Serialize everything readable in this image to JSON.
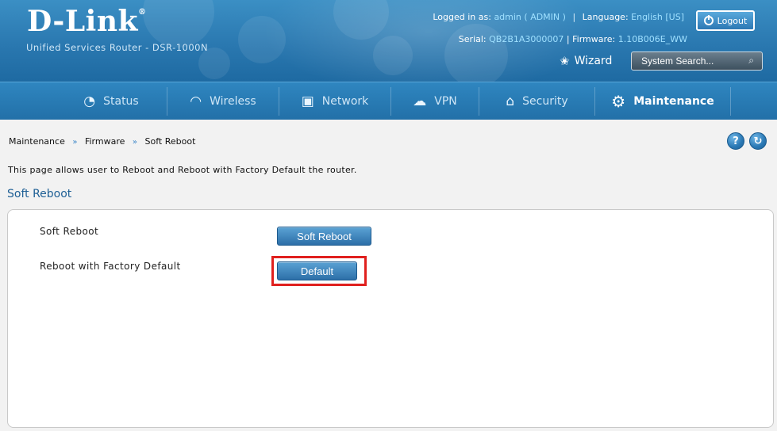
{
  "brand": {
    "logo": "D-Link",
    "registered": "®",
    "subtitle": "Unified Services Router - DSR-1000N"
  },
  "session": {
    "logged_in_label": "Logged in as:",
    "user": "admin ( ADMIN )",
    "language_label": "Language:",
    "language": "English [US]",
    "serial_label": "Serial:",
    "serial": "QB2B1A3000007",
    "firmware_label": "Firmware:",
    "firmware": "1.10B006E_WW"
  },
  "header": {
    "logout_label": "Logout",
    "wizard_label": "Wizard",
    "search_placeholder": "System Search..."
  },
  "nav": {
    "items": [
      {
        "label": "Status",
        "icon": "gauge-icon"
      },
      {
        "label": "Wireless",
        "icon": "wifi-icon"
      },
      {
        "label": "Network",
        "icon": "monitor-icon"
      },
      {
        "label": "VPN",
        "icon": "cloud-lock-icon"
      },
      {
        "label": "Security",
        "icon": "lock-icon"
      },
      {
        "label": "Maintenance",
        "icon": "gears-icon",
        "active": true
      }
    ]
  },
  "breadcrumb": [
    "Maintenance",
    "Firmware",
    "Soft Reboot"
  ],
  "page": {
    "description": "This page allows user to Reboot and Reboot with Factory Default the router.",
    "section_title": "Soft Reboot",
    "rows": [
      {
        "label": "Soft Reboot",
        "button": "Soft Reboot"
      },
      {
        "label": "Reboot with Factory Default",
        "button": "Default"
      }
    ]
  },
  "colors": {
    "header_blue": "#2a78b0",
    "accent_link": "#9fe0ff",
    "highlight_red": "#e0201e"
  }
}
